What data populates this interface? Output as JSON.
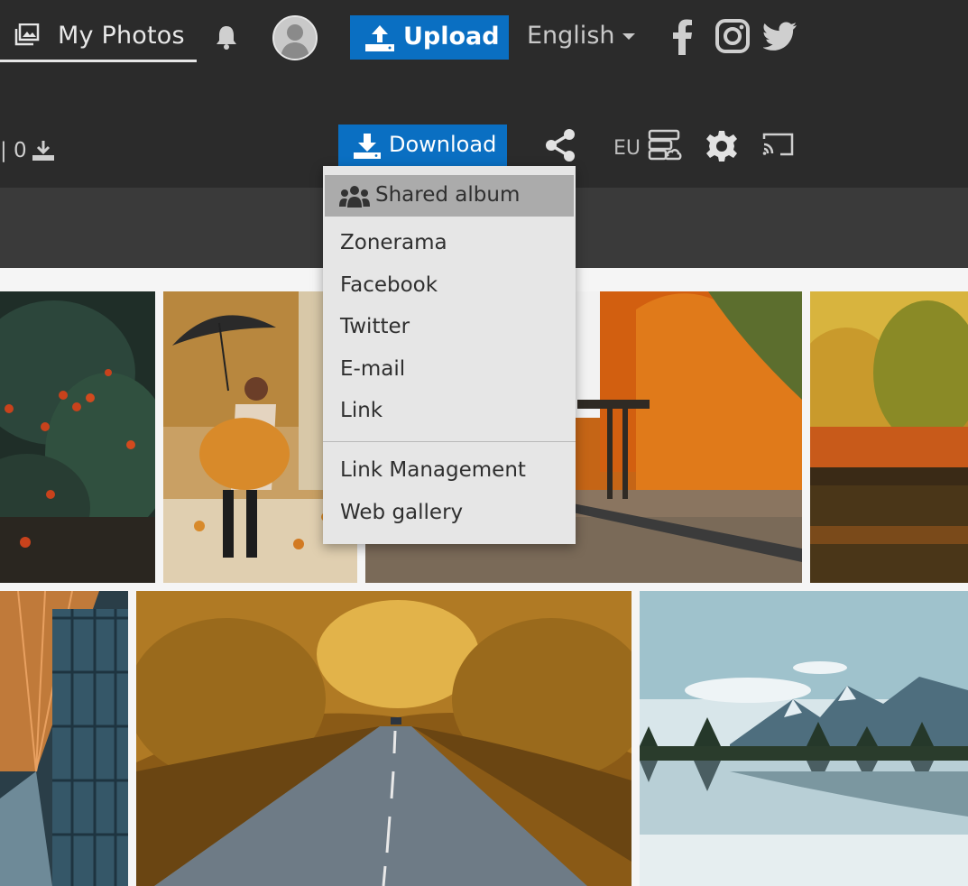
{
  "colors": {
    "topbar": "#2b2b2b",
    "accent": "#0a6fc2",
    "menu_bg": "#e6e6e6",
    "menu_active": "#ababab"
  },
  "header": {
    "my_photos_label": "My Photos",
    "upload_label": "Upload",
    "language": "English",
    "icons": [
      "photos-icon",
      "bell-icon",
      "avatar",
      "upload-icon",
      "facebook-icon",
      "instagram-icon",
      "twitter-icon"
    ]
  },
  "toolbar": {
    "counter": "| 0",
    "download_label": "Download",
    "region": "EU"
  },
  "share_menu": {
    "items": [
      {
        "label": "Shared album"
      },
      {
        "label": "Zonerama"
      },
      {
        "label": "Facebook"
      },
      {
        "label": "Twitter"
      },
      {
        "label": "E-mail"
      },
      {
        "label": "Link"
      }
    ],
    "secondary_items": [
      {
        "label": "Link Management"
      },
      {
        "label": "Web gallery"
      }
    ]
  }
}
